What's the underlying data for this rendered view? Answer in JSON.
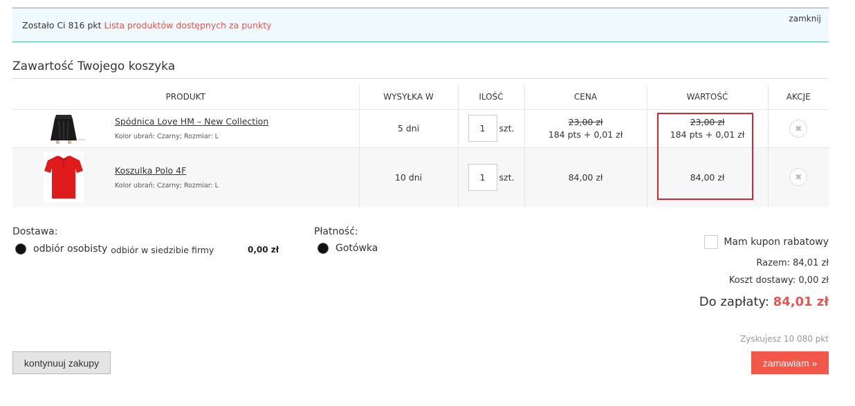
{
  "notice": {
    "text": "Zostało Ci 816 pkt",
    "link": "Lista produktów dostępnych za punkty",
    "close": "zamknij"
  },
  "cart": {
    "title": "Zawartość Twojego koszyka",
    "columns": [
      "PRODUKT",
      "WYSYŁKA W",
      "ILOŚĆ",
      "CENA",
      "WARTOŚĆ",
      "AKCJE"
    ],
    "items": [
      {
        "name": "Spódnica Love HM – New Collection",
        "attrs": "Kolor ubrań: Czarny; Rozmiar: L",
        "shipping": "5 dni",
        "qty": "1",
        "unit": "szt.",
        "price_old": "23,00 zł",
        "price": "184 pts + 0,01 zł",
        "value_old": "23,00 zł",
        "value": "184 pts + 0,01 zł",
        "image": "black-skirt-thumbnail"
      },
      {
        "name": "Koszulka Polo 4F",
        "attrs": "Kolor ubrań: Czarny; Rozmiar: L",
        "shipping": "10 dni",
        "qty": "1",
        "unit": "szt.",
        "price": "84,00 zł",
        "value": "84,00 zł",
        "image": "red-polo-thumbnail"
      }
    ],
    "remove_icon": "remove-circle-icon"
  },
  "delivery": {
    "label": "Dostawa:",
    "option": "odbiór osobisty",
    "option_desc": "odbiór w siedzibie firmy",
    "price": "0,00 zł"
  },
  "payment": {
    "label": "Płatność:",
    "option": "Gotówka"
  },
  "summary": {
    "coupon": "Mam kupon rabatowy",
    "subtotal": "Razem: 84,01 zł",
    "shipping": "Koszt dostawy: 0,00 zł",
    "total_label": "Do zapłaty:",
    "total": "84,01 zł",
    "points": "Zyskujesz 10 080 pkt"
  },
  "buttons": {
    "continue": "kontynuuj zakupy",
    "order": "zamawiam »"
  },
  "colors": {
    "accent": "#e8554e",
    "order_button": "#f2574a",
    "notice_bg": "#eefaff",
    "notice_border": "#4db6d4",
    "highlight": "#d9232d"
  }
}
